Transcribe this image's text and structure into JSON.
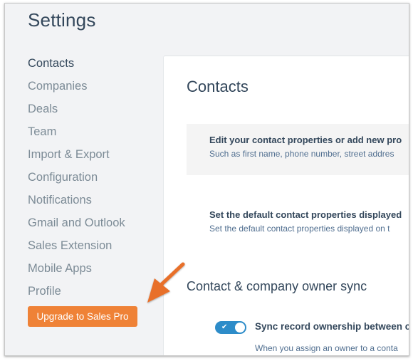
{
  "page": {
    "title": "Settings"
  },
  "sidebar": {
    "items": [
      {
        "label": "Contacts",
        "active": true
      },
      {
        "label": "Companies"
      },
      {
        "label": "Deals"
      },
      {
        "label": "Team"
      },
      {
        "label": "Import & Export"
      },
      {
        "label": "Configuration"
      },
      {
        "label": "Notifications"
      },
      {
        "label": "Gmail and Outlook"
      },
      {
        "label": "Sales Extension"
      },
      {
        "label": "Mobile Apps"
      },
      {
        "label": "Profile"
      }
    ],
    "upgrade_button": "Upgrade to Sales Pro"
  },
  "main": {
    "title": "Contacts",
    "items": [
      {
        "title": "Edit your contact properties or add new pro",
        "subtitle": "Such as first name, phone number, street addres"
      },
      {
        "title": "Set the default contact properties displayed",
        "subtitle": "Set the default contact properties displayed on t"
      }
    ],
    "sync_section": {
      "title": "Contact & company owner sync",
      "toggle": {
        "label": "Sync record ownership between c",
        "description": "When you assign an owner to a conta",
        "enabled": true,
        "check_glyph": "✔"
      }
    }
  },
  "colors": {
    "accent_orange": "#ef8237",
    "toggle_blue": "#2d8cc9",
    "text_dark": "#33475b",
    "nav_grey": "#7c8b96"
  }
}
